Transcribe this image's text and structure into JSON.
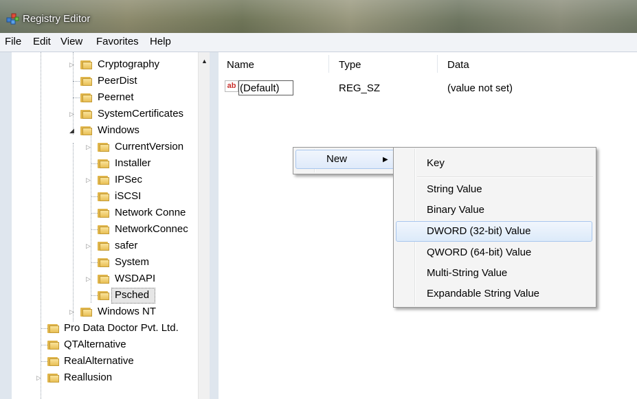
{
  "window": {
    "title": "Registry Editor",
    "icon": "registry-icon"
  },
  "menubar": [
    "File",
    "Edit",
    "View",
    "Favorites",
    "Help"
  ],
  "tree": [
    {
      "label": "Cryptography",
      "expander": "collapsed"
    },
    {
      "label": "PeerDist",
      "expander": "none"
    },
    {
      "label": "Peernet",
      "expander": "none"
    },
    {
      "label": "SystemCertificates",
      "expander": "collapsed"
    },
    {
      "label": "Windows",
      "expander": "expanded"
    },
    {
      "label": "CurrentVersion",
      "expander": "collapsed"
    },
    {
      "label": "Installer",
      "expander": "none"
    },
    {
      "label": "IPSec",
      "expander": "collapsed"
    },
    {
      "label": "iSCSI",
      "expander": "none"
    },
    {
      "label": "Network Conne",
      "expander": "none"
    },
    {
      "label": "NetworkConnec",
      "expander": "none"
    },
    {
      "label": "safer",
      "expander": "collapsed"
    },
    {
      "label": "System",
      "expander": "none"
    },
    {
      "label": "WSDAPI",
      "expander": "collapsed"
    },
    {
      "label": "Psched",
      "expander": "none",
      "selected": true
    },
    {
      "label": "Windows NT",
      "expander": "collapsed"
    },
    {
      "label": "Pro Data Doctor Pvt. Ltd.",
      "expander": "none"
    },
    {
      "label": "QTAlternative",
      "expander": "none"
    },
    {
      "label": "RealAlternative",
      "expander": "none"
    },
    {
      "label": "Reallusion",
      "expander": "collapsed"
    }
  ],
  "list": {
    "columns": [
      "Name",
      "Type",
      "Data"
    ],
    "rows": [
      {
        "icon": "ab",
        "name": "(Default)",
        "type": "REG_SZ",
        "data": "(value not set)"
      }
    ]
  },
  "context_menu": {
    "new_label": "New"
  },
  "submenu": {
    "items": [
      "Key",
      "String Value",
      "Binary Value",
      "DWORD (32-bit) Value",
      "QWORD (64-bit) Value",
      "Multi-String Value",
      "Expandable String Value"
    ],
    "highlighted": "DWORD (32-bit) Value"
  },
  "colors": {
    "folder": "#e8bf55",
    "highlight_border": "#a8c6ee"
  }
}
